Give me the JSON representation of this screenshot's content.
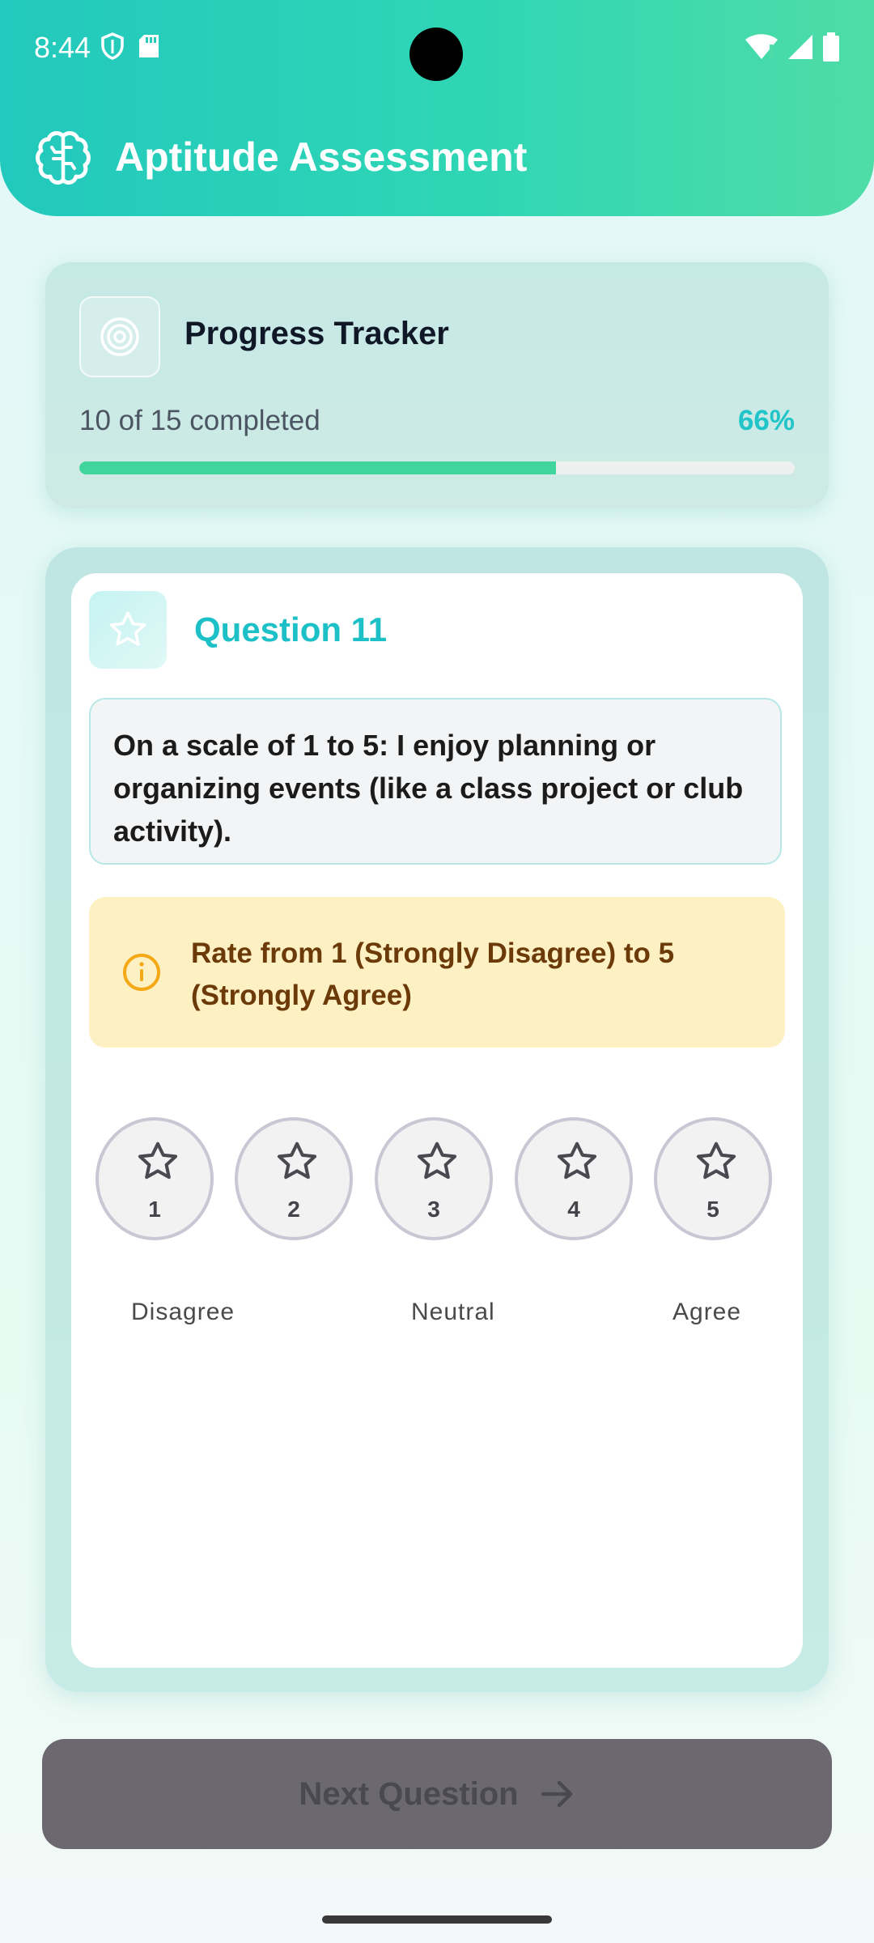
{
  "status_bar": {
    "time": "8:44",
    "icons": [
      "shield-icon",
      "sd-card-icon",
      "wifi-icon",
      "signal-icon",
      "battery-icon"
    ]
  },
  "app_bar": {
    "title": "Aptitude Assessment",
    "icon": "brain-icon",
    "gradient": [
      "#22c9bd",
      "#4fdca7"
    ]
  },
  "progress": {
    "title": "Progress Tracker",
    "icon": "target-icon",
    "completed_text": "10 of 15 completed",
    "percent_text": "66%",
    "fraction": 0.666,
    "bar_color": "#3fd59c"
  },
  "question": {
    "label": "Question 11",
    "icon": "star-icon",
    "text": "On a scale of 1 to 5: I enjoy planning or organizing events (like a class project or club activity).",
    "info_icon": "info-icon",
    "info_text": "Rate from 1 (Strongly Disagree) to 5 (Strongly Agree)",
    "options": [
      "1",
      "2",
      "3",
      "4",
      "5"
    ],
    "scale_labels": {
      "low": "Disagree",
      "mid": "Neutral",
      "high": "Agree"
    }
  },
  "next_button": {
    "label": "Next Question",
    "icon": "arrow-right-icon",
    "enabled": false
  },
  "colors": {
    "accent": "#1dc0c6",
    "info_bg": "#fdf1c4",
    "info_text": "#6b3a08"
  }
}
